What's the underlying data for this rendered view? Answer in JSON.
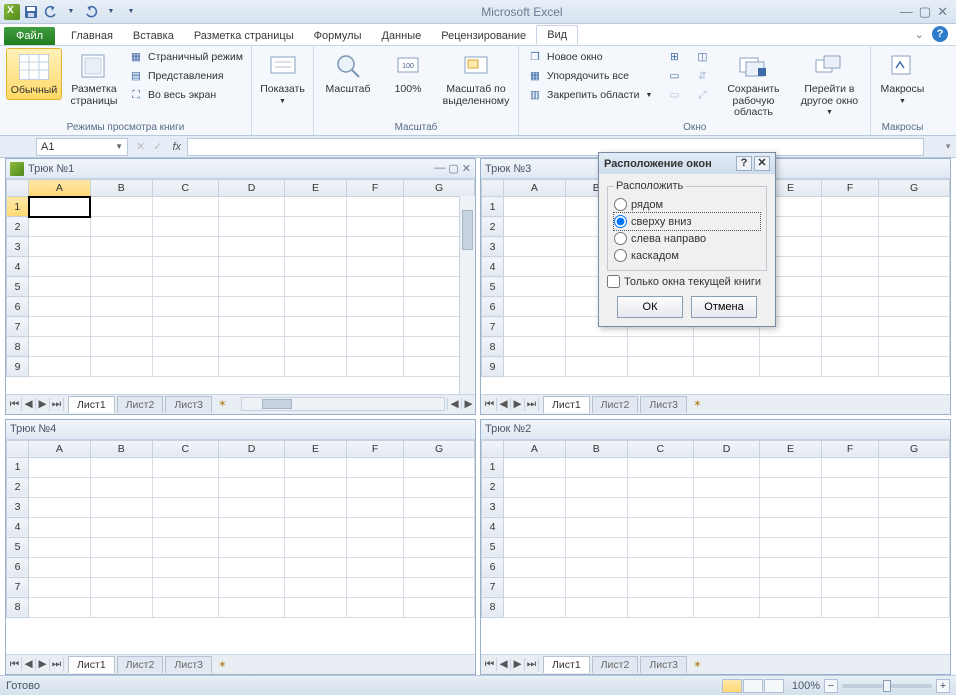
{
  "app_title": "Microsoft Excel",
  "qat": {
    "save_icon": "save",
    "undo_icon": "undo",
    "redo_icon": "redo"
  },
  "tabs": {
    "file": "Файл",
    "items": [
      "Главная",
      "Вставка",
      "Разметка страницы",
      "Формулы",
      "Данные",
      "Рецензирование",
      "Вид"
    ],
    "active_index": 6
  },
  "ribbon": {
    "group_views": {
      "label": "Режимы просмотра книги",
      "normal": "Обычный",
      "page_layout": "Разметка\nстраницы",
      "page_break": "Страничный режим",
      "custom_views": "Представления",
      "full_screen": "Во весь экран"
    },
    "group_show": {
      "btn": "Показать"
    },
    "group_zoom": {
      "label": "Масштаб",
      "zoom": "Масштаб",
      "p100": "100%",
      "to_selection": "Масштаб по\nвыделенному"
    },
    "group_window": {
      "label": "Окно",
      "new_window": "Новое окно",
      "arrange_all": "Упорядочить все",
      "freeze": "Закрепить области",
      "save_ws": "Сохранить\nрабочую область",
      "switch": "Перейти в\nдругое окно"
    },
    "group_macros": {
      "label": "Макросы",
      "btn": "Макросы"
    }
  },
  "formula_bar": {
    "name_box": "A1",
    "fx": "fx",
    "formula": ""
  },
  "workbooks": [
    {
      "title": "Трюк №1",
      "active": true,
      "columns": [
        "A",
        "B",
        "C",
        "D",
        "E",
        "F",
        "G"
      ],
      "rows": [
        1,
        2,
        3,
        4,
        5,
        6,
        7,
        8,
        9
      ],
      "sheets": [
        "Лист1",
        "Лист2",
        "Лист3"
      ],
      "active_sheet": 0,
      "selected_cell": "A1"
    },
    {
      "title": "Трюк №3",
      "active": false,
      "columns": [
        "A",
        "B",
        "C",
        "D",
        "E",
        "F",
        "G"
      ],
      "rows": [
        1,
        2,
        3,
        4,
        5,
        6,
        7,
        8,
        9
      ],
      "sheets": [
        "Лист1",
        "Лист2",
        "Лист3"
      ],
      "active_sheet": 0
    },
    {
      "title": "Трюк №4",
      "active": false,
      "columns": [
        "A",
        "B",
        "C",
        "D",
        "E",
        "F",
        "G"
      ],
      "rows": [
        1,
        2,
        3,
        4,
        5,
        6,
        7,
        8
      ],
      "sheets": [
        "Лист1",
        "Лист2",
        "Лист3"
      ],
      "active_sheet": 0
    },
    {
      "title": "Трюк №2",
      "active": false,
      "columns": [
        "A",
        "B",
        "C",
        "D",
        "E",
        "F",
        "G"
      ],
      "rows": [
        1,
        2,
        3,
        4,
        5,
        6,
        7,
        8
      ],
      "sheets": [
        "Лист1",
        "Лист2",
        "Лист3"
      ],
      "active_sheet": 0
    }
  ],
  "dialog": {
    "title": "Расположение окон",
    "group_label": "Расположить",
    "options": [
      "рядом",
      "сверху вниз",
      "слева направо",
      "каскадом"
    ],
    "selected_index": 1,
    "checkbox": "Только окна текущей книги",
    "checkbox_checked": false,
    "ok": "ОК",
    "cancel": "Отмена"
  },
  "status": {
    "ready": "Готово",
    "zoom_pct": "100%"
  }
}
